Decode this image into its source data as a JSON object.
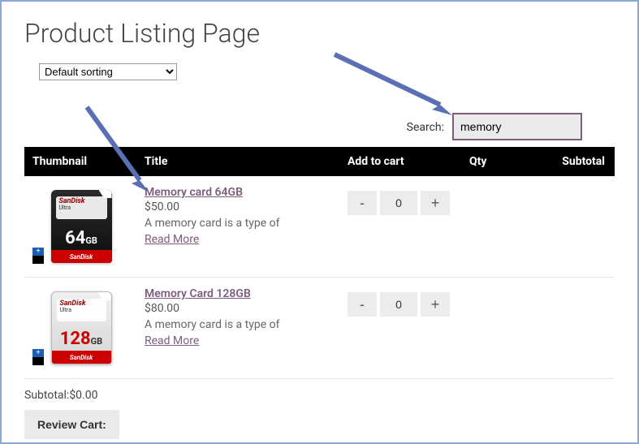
{
  "page": {
    "title": "Product Listing Page"
  },
  "sorting": {
    "selected": "Default sorting"
  },
  "search": {
    "label": "Search:",
    "value": "memory"
  },
  "columns": {
    "thumbnail": "Thumbnail",
    "title": "Title",
    "addtocart": "Add to cart",
    "qty": "Qty",
    "subtotal": "Subtotal"
  },
  "products": [
    {
      "title": "Memory card 64GB",
      "price": "$50.00",
      "desc": "A memory card is a type of",
      "readmore": "Read More",
      "qty": "0",
      "capacity": "64",
      "unit": "GB"
    },
    {
      "title": "Memory Card 128GB",
      "price": "$80.00",
      "desc": "A memory card is a type of",
      "readmore": "Read More",
      "qty": "0",
      "capacity": "128",
      "unit": "GB"
    }
  ],
  "footer": {
    "subtotal_label": "Subtotal:",
    "subtotal_value": "$0.00",
    "review_cart": "Review Cart:"
  },
  "ui": {
    "minus": "-",
    "plus": "+",
    "brand": "SanDisk",
    "ultra": "Ultra"
  }
}
